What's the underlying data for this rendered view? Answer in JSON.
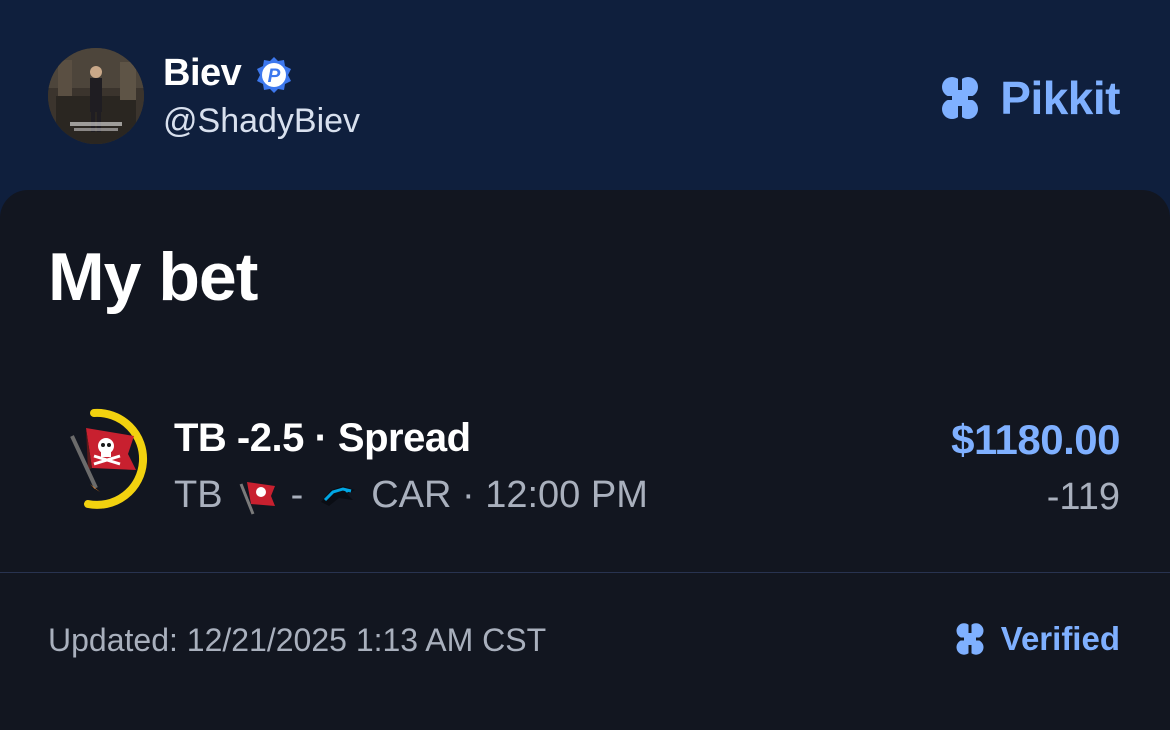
{
  "header": {
    "user_name": "Biev",
    "user_handle": "@ShadyBiev",
    "badge_letter": "P",
    "brand_name": "Pikkit",
    "brand_icon": "clover-icon"
  },
  "card": {
    "title": "My bet",
    "bet": {
      "selection": "TB -2.5 · Spread",
      "home_team": "TB",
      "separator": "-",
      "away_team": "CAR · 12:00 PM",
      "amount": "$1180.00",
      "odds": "-119",
      "team_logo": "buccaneers-flag-icon",
      "away_logo": "panthers-icon"
    },
    "footer": {
      "updated": "Updated: 12/21/2025 1:13 AM CST",
      "verified": "Verified"
    }
  },
  "colors": {
    "header_bg": "#0f1f3d",
    "card_bg": "#121620",
    "accent": "#7fb0ff",
    "progress_ring": "#f2d20f",
    "bucs_red": "#c8202f"
  }
}
